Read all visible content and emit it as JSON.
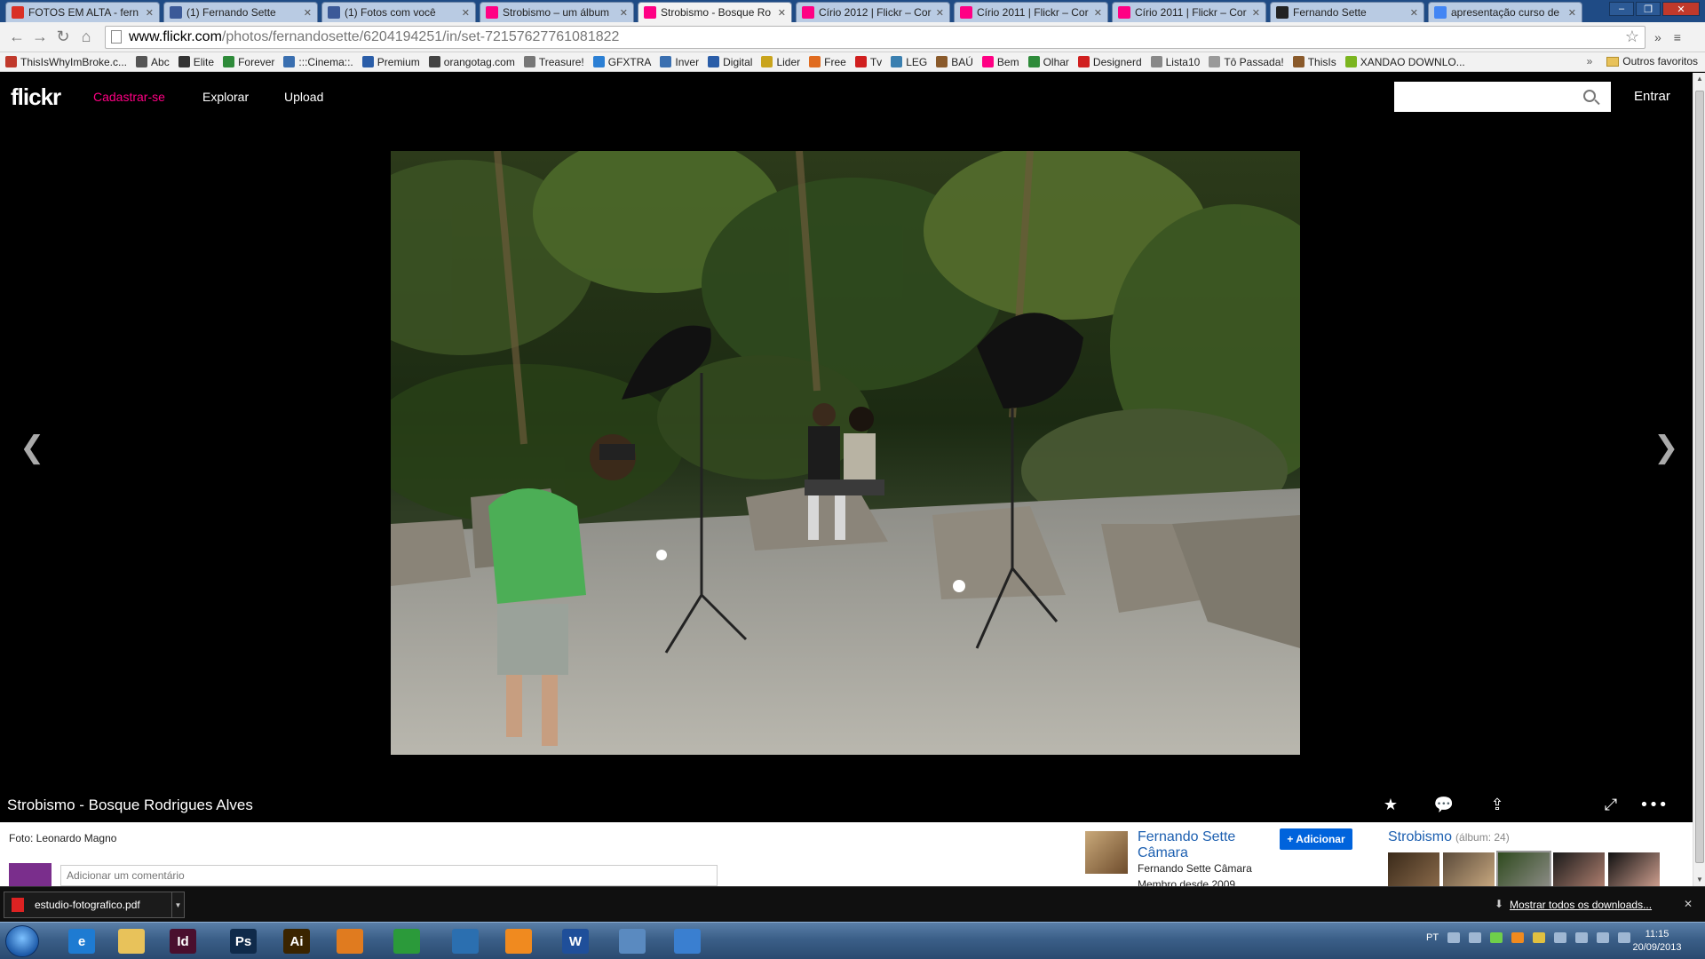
{
  "browser": {
    "tabs": [
      {
        "title": "FOTOS EM ALTA - fern",
        "icon": "gmail-icon",
        "color": "#d93025"
      },
      {
        "title": "(1) Fernando Sette",
        "icon": "facebook-icon",
        "color": "#3b5998"
      },
      {
        "title": "(1) Fotos com você",
        "icon": "facebook-icon",
        "color": "#3b5998"
      },
      {
        "title": "Strobismo – um álbum",
        "icon": "flickr-icon",
        "color": "#ff0084"
      },
      {
        "title": "Strobismo - Bosque Ro",
        "icon": "flickr-icon",
        "color": "#ff0084",
        "active": true
      },
      {
        "title": "Círio 2012 | Flickr – Cor",
        "icon": "flickr-icon",
        "color": "#ff0084"
      },
      {
        "title": "Círio 2011 | Flickr – Cor",
        "icon": "flickr-icon",
        "color": "#ff0084"
      },
      {
        "title": "Círio 2011 | Flickr – Cor",
        "icon": "flickr-icon",
        "color": "#ff0084"
      },
      {
        "title": "Fernando Sette",
        "icon": "site-icon",
        "color": "#222222"
      },
      {
        "title": "apresentação curso de",
        "icon": "google-icon",
        "color": "#4285f4"
      }
    ],
    "url_host": "www.flickr.com",
    "url_path": "/photos/fernandosette/6204194251/in/set-72157627761081822",
    "bookmarks": [
      {
        "label": "ThisIsWhyImBroke.c...",
        "color": "#c0392b"
      },
      {
        "label": "Abc",
        "color": "#555555"
      },
      {
        "label": "Elite",
        "color": "#333333"
      },
      {
        "label": "Forever",
        "color": "#2e8b3a"
      },
      {
        "label": ":::Cinema::.",
        "color": "#3a6fb0"
      },
      {
        "label": "Premium",
        "color": "#2a5da8"
      },
      {
        "label": "orangotag.com",
        "color": "#444444"
      },
      {
        "label": "Treasure!",
        "color": "#777777"
      },
      {
        "label": "GFXTRA",
        "color": "#2b7fd4"
      },
      {
        "label": "Inver",
        "color": "#3a6fb0"
      },
      {
        "label": "Digital",
        "color": "#2a5da8"
      },
      {
        "label": "Lider",
        "color": "#c9a41c"
      },
      {
        "label": "Free",
        "color": "#e06b1f"
      },
      {
        "label": "Tv",
        "color": "#d01f1f"
      },
      {
        "label": "LEG",
        "color": "#3a7fb0"
      },
      {
        "label": "BAÚ",
        "color": "#8a5a2b"
      },
      {
        "label": "Bem",
        "color": "#ff0084"
      },
      {
        "label": "Olhar",
        "color": "#2e8b3a"
      },
      {
        "label": "Designerd",
        "color": "#d01f1f"
      },
      {
        "label": "Lista10",
        "color": "#888888"
      },
      {
        "label": "Tô Passada!",
        "color": "#999999"
      },
      {
        "label": "ThisIs",
        "color": "#8a5a2b"
      },
      {
        "label": "XANDAO DOWNLO...",
        "color": "#7bb51f"
      }
    ],
    "bookmarks_overflow": "»",
    "other_bookmarks": "Outros favoritos"
  },
  "flickr": {
    "logo": "flickr",
    "nav": {
      "signup": "Cadastrar-se",
      "explore": "Explorar",
      "upload": "Upload"
    },
    "signin": "Entrar",
    "search_placeholder": "",
    "photo_title": "Strobismo - Bosque Rodrigues Alves",
    "credit": "Foto: Leonardo Magno",
    "comment_placeholder": "Adicionar um comentário",
    "owner": {
      "name": "Fernando Sette Câmara",
      "realname": "Fernando Sette Câmara",
      "since": "Membro desde 2009"
    },
    "add_button": "+ Adicionar",
    "album": {
      "title": "Strobismo",
      "count": "(álbum: 24)"
    },
    "brand_color": "#ff0084",
    "link_color": "#1c5fb0"
  },
  "downloads": {
    "file": "estudio-fotografico.pdf",
    "show_all": "Mostrar todos os downloads..."
  },
  "taskbar": {
    "apps": [
      {
        "icon": "internet-explorer-icon",
        "label": "e",
        "color": "#1e7bd2"
      },
      {
        "icon": "explorer-folder-icon",
        "label": "",
        "color": "#e8c25a"
      },
      {
        "icon": "indesign-icon",
        "label": "Id",
        "color": "#4a0f2e"
      },
      {
        "icon": "photoshop-icon",
        "label": "Ps",
        "color": "#0f2a4a"
      },
      {
        "icon": "illustrator-icon",
        "label": "Ai",
        "color": "#3a2400"
      },
      {
        "icon": "media-player-icon",
        "label": "",
        "color": "#e07b1f"
      },
      {
        "icon": "chrome-icon",
        "label": "",
        "color": "#2b9a3a"
      },
      {
        "icon": "network-icon",
        "label": "",
        "color": "#2b6fb0"
      },
      {
        "icon": "orange-app-icon",
        "label": "",
        "color": "#f08a1f"
      },
      {
        "icon": "word-icon",
        "label": "W",
        "color": "#1f4f9a"
      },
      {
        "icon": "control-panel-icon",
        "label": "",
        "color": "#5a8ac0"
      },
      {
        "icon": "itunes-icon",
        "label": "",
        "color": "#3a7fd0"
      }
    ],
    "lang": "PT",
    "time": "11:15",
    "date": "20/09/2013"
  }
}
